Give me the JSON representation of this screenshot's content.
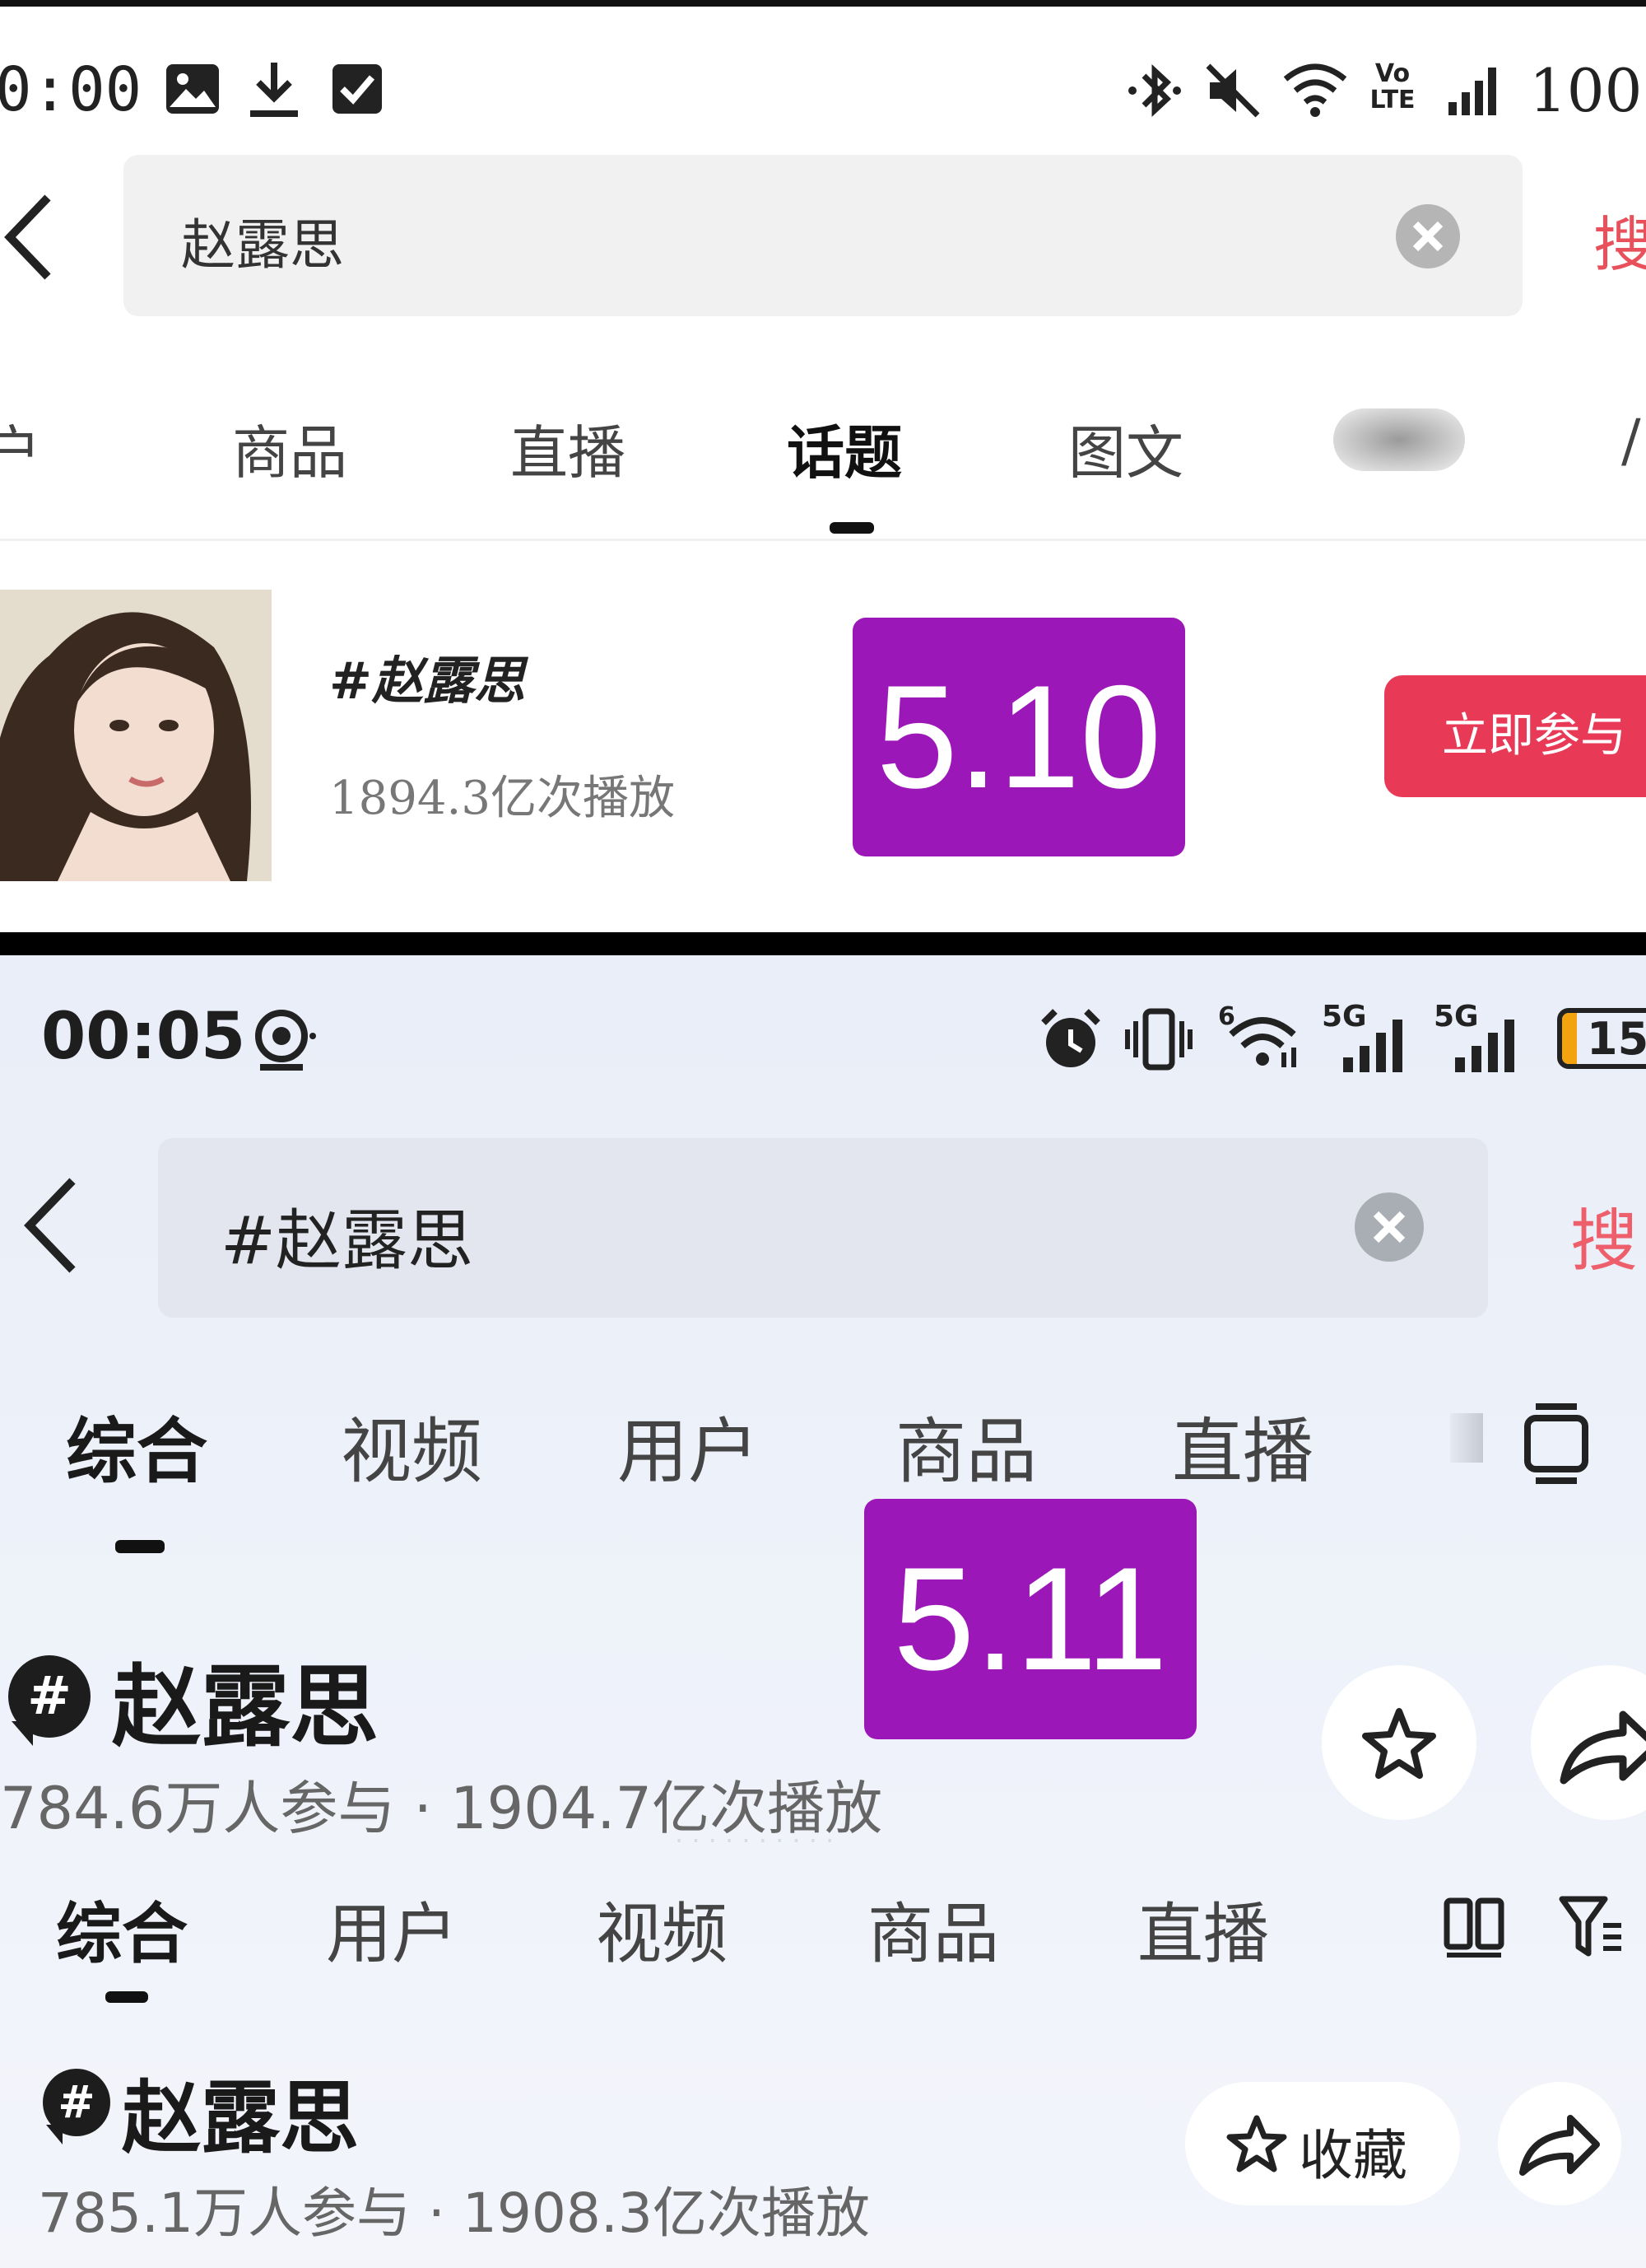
{
  "screen1": {
    "status": {
      "time": "0:00",
      "battery": "100"
    },
    "search": {
      "query": "赵露思",
      "button": "搜"
    },
    "tabs": [
      {
        "label": "户"
      },
      {
        "label": "商品"
      },
      {
        "label": "直播"
      },
      {
        "label": "话题"
      },
      {
        "label": "图文"
      },
      {
        "label": ""
      },
      {
        "label": "/"
      }
    ],
    "active_tab": "话题",
    "topic": {
      "title": "#赵露思",
      "plays": "1894.3亿次播放",
      "join_button": "立即参与"
    },
    "date_badge": "5.10"
  },
  "screen2": {
    "status": {
      "time": "00:05",
      "battery": "15",
      "net1": "5G",
      "net2": "5G"
    },
    "search": {
      "query": "#赵露思",
      "button": "搜"
    },
    "tabs": [
      {
        "label": "综合"
      },
      {
        "label": "视频"
      },
      {
        "label": "用户"
      },
      {
        "label": "商品"
      },
      {
        "label": "直播"
      },
      {
        "label": ""
      }
    ],
    "active_tab": "综合",
    "date_badge": "5.11",
    "topic": {
      "hash": "#",
      "title": "赵露思",
      "stats": "784.6万人参与 · 1904.7亿次播放"
    },
    "tabs2": [
      {
        "label": "综合"
      },
      {
        "label": "用户"
      },
      {
        "label": "视频"
      },
      {
        "label": "商品"
      },
      {
        "label": "直播"
      }
    ],
    "topic2": {
      "hash": "#",
      "title": "赵露思",
      "stats": "785.1万人参与 · 1908.3亿次播放",
      "favorite_button": "收藏"
    }
  },
  "colors": {
    "badge": "#9b17b8",
    "join_button": "#e83a57",
    "search_button": "#e8505b"
  },
  "icons": [
    "gallery-icon",
    "download-icon",
    "checkbox-icon",
    "bluetooth-icon",
    "mute-icon",
    "wifi-icon",
    "signal-icon",
    "back-icon",
    "clear-icon",
    "alarm-icon",
    "vibrate-icon",
    "battery-icon",
    "star-icon",
    "share-icon",
    "layout-icon",
    "filter-icon"
  ]
}
